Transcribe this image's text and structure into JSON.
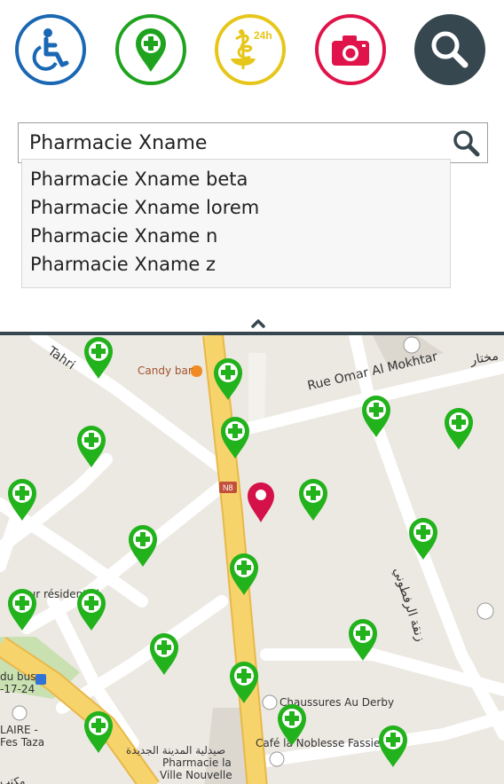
{
  "categories": [
    {
      "name": "accessibility",
      "icon": "wheelchair-icon",
      "color": "#1a67b3"
    },
    {
      "name": "pharmacy",
      "icon": "pharmacy-pin-icon",
      "color": "#1fa31f"
    },
    {
      "name": "pharmacy-24h",
      "icon": "caduceus-24h-icon",
      "color": "#e6c619"
    },
    {
      "name": "photo",
      "icon": "camera-icon",
      "color": "#e0134a"
    },
    {
      "name": "search",
      "icon": "magnifier-icon",
      "color": "#37474f"
    }
  ],
  "badge_24h": "24h",
  "search": {
    "value": "Pharmacie Xname",
    "suggestions": [
      "Pharmacie Xname beta",
      "Pharmacie Xname lorem",
      "Pharmacie Xname n",
      "Pharmacie Xname z"
    ]
  },
  "map": {
    "labels": {
      "candy_bar": "Candy bar",
      "rue_omar": "Rue Omar Al Mokhtar",
      "arabic_mokhtar": "مختار",
      "tahri": "Tahri",
      "n8": "N8",
      "residential": "Tour résidentiel",
      "du_bus": "du bus",
      "seventeen": "-17-24",
      "laire": "LAIRE -",
      "fes_taza": "Fes Taza",
      "arabic_street": "زنقة الرفطوني",
      "chaussures": "Chaussures Au Derby",
      "cafe": "Café la Noblesse Fassie",
      "arabic_pharmacy": "صيدلية المدينة الجديدة",
      "pharmacie_la": "Pharmacie la",
      "ville_nouvelle": "Ville Nouvelle",
      "arabic_bottom": "مكتب"
    },
    "colors": {
      "pharmacy_pin": "#22b21c",
      "location_pin": "#d41149",
      "road_major": "#f7d46b",
      "park": "#c9e0b0"
    }
  }
}
